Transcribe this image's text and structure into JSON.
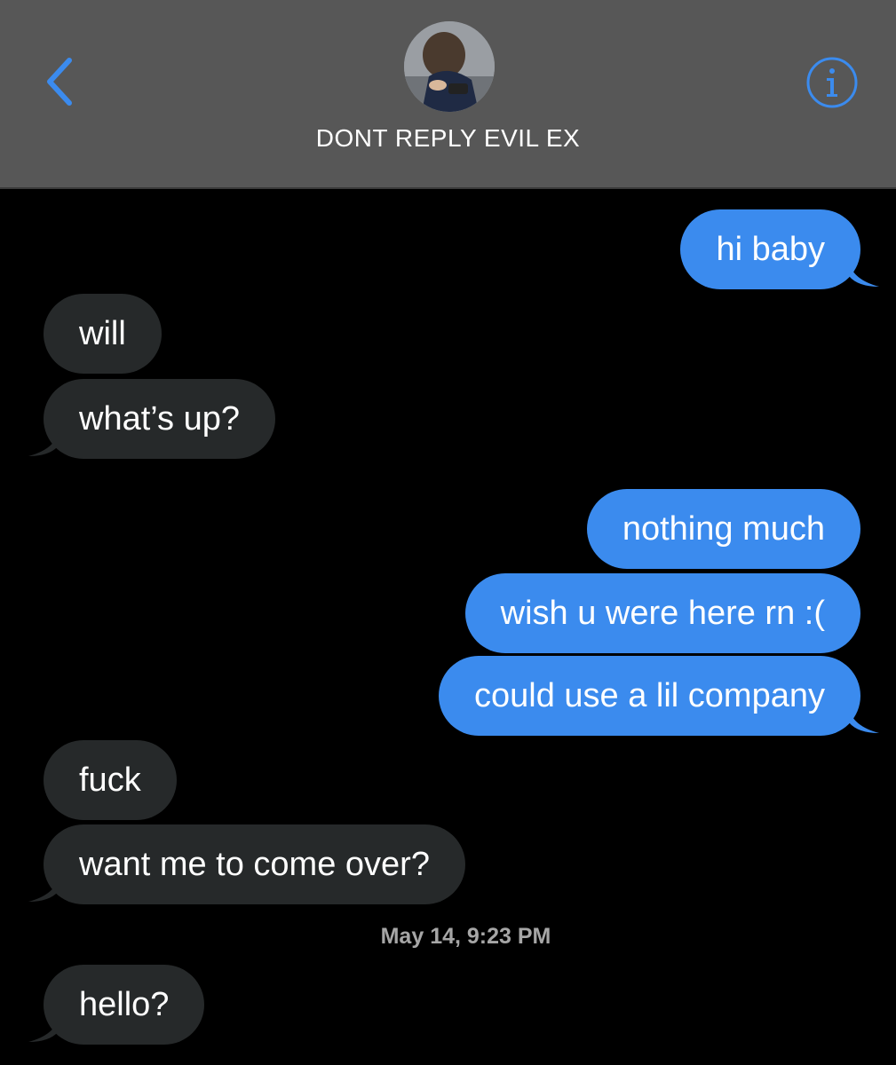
{
  "header": {
    "contact_name": "DONT REPLY EVIL EX",
    "back_icon": "chevron-left-icon",
    "info_icon": "info-icon",
    "accent_color": "#3b8bee",
    "background_color": "#575757"
  },
  "messages": [
    {
      "direction": "outgoing",
      "text": "hi baby"
    },
    {
      "direction": "incoming",
      "text": "will"
    },
    {
      "direction": "incoming",
      "text": "what’s up?"
    },
    {
      "direction": "outgoing",
      "text": "nothing much"
    },
    {
      "direction": "outgoing",
      "text": "wish u were here rn :("
    },
    {
      "direction": "outgoing",
      "text": "could use a lil company"
    },
    {
      "direction": "incoming",
      "text": "fuck"
    },
    {
      "direction": "incoming",
      "text": "want me to come over?"
    },
    {
      "direction": "incoming",
      "text": "hello?"
    }
  ],
  "timestamp": "May 14, 9:23 PM",
  "colors": {
    "outgoing_bubble": "#3b8bee",
    "incoming_bubble": "#26292a",
    "timestamp_text": "#a6a6a6"
  }
}
